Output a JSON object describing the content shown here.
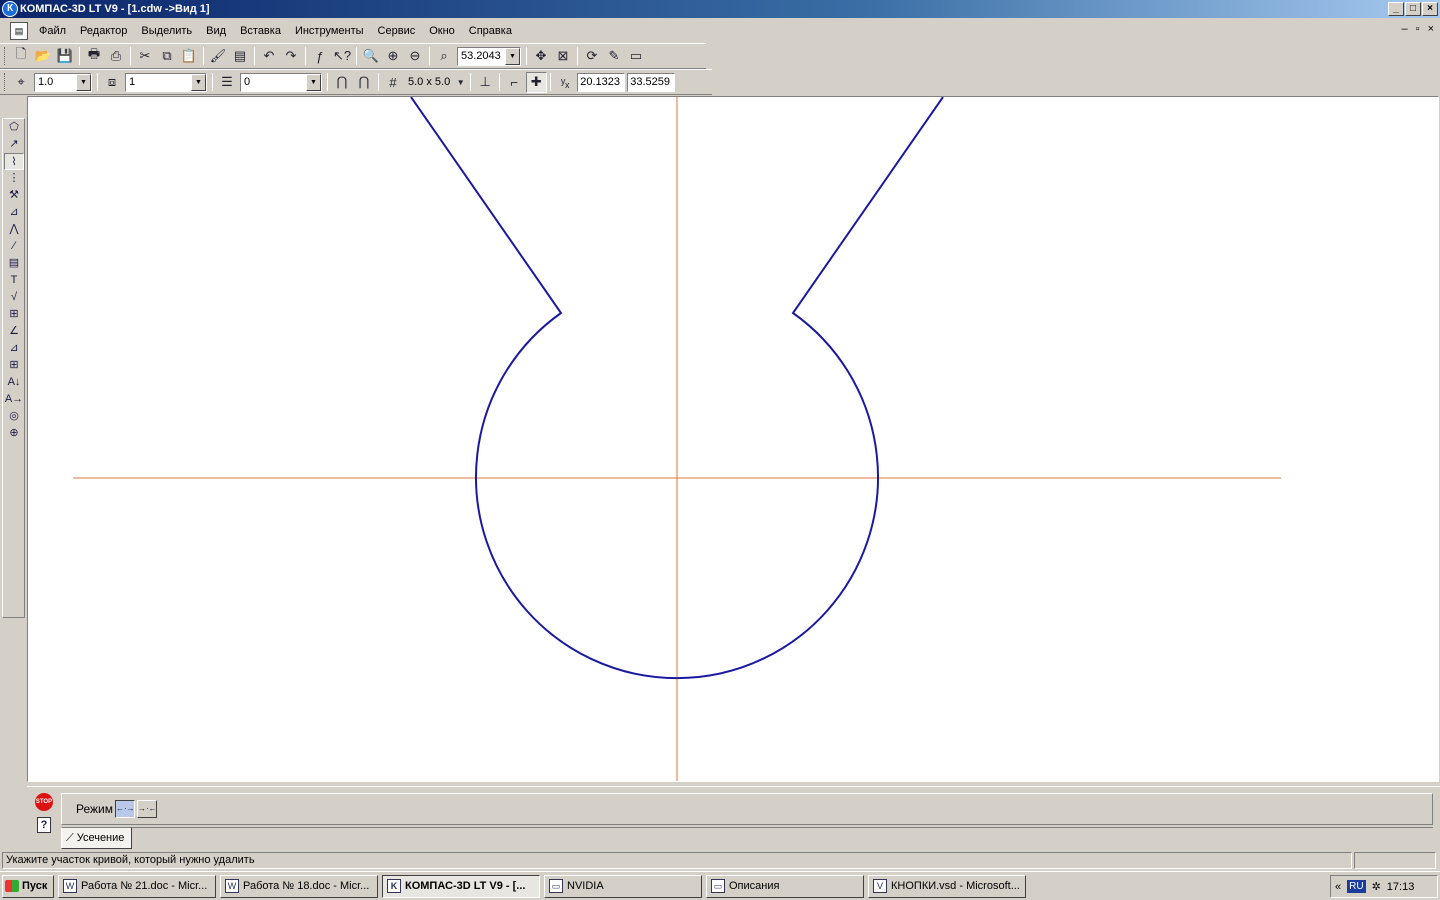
{
  "window": {
    "title": "КОМПАС-3D LT V9 - [1.cdw ->Вид 1]",
    "app_icon": "К",
    "buttons": [
      "_",
      "□",
      "×"
    ]
  },
  "menu": {
    "items": [
      "Файл",
      "Редактор",
      "Выделить",
      "Вид",
      "Вставка",
      "Инструменты",
      "Сервис",
      "Окно",
      "Справка"
    ],
    "mdi_buttons": [
      "–",
      "▫",
      "×"
    ]
  },
  "toolbar_standard": {
    "zoom_value": "53.2043"
  },
  "toolbar_current_state": {
    "step_value": "1.0",
    "layer_value": "1",
    "style_value": "0",
    "grid_label": "5.0 x 5.0",
    "coord_x": "20.1323",
    "coord_y": "33.5259"
  },
  "properties_panel": {
    "mode_label": "Режим",
    "tab_label": "Усечение",
    "stop_label": "STOP",
    "help_label": "?"
  },
  "statusbar": {
    "message": "Укажите участок кривой, который нужно удалить",
    "extra": ""
  },
  "taskbar": {
    "start_label": "Пуск",
    "tasks": [
      {
        "label": "Работа № 21.doc - Micr...",
        "icon": "W"
      },
      {
        "label": "Работа № 18.doc - Micr...",
        "icon": "W"
      },
      {
        "label": "КОМПАС-3D LT V9 - [...",
        "icon": "K"
      },
      {
        "label": "NVIDIA",
        "icon": "▭"
      },
      {
        "label": "Описания",
        "icon": "▭"
      },
      {
        "label": "КНОПКИ.vsd - Microsoft...",
        "icon": "V"
      }
    ],
    "tray_chevron": "«",
    "lang": "RU",
    "clock": "17:13"
  },
  "colors": {
    "contour": "#1a1aa0",
    "axis": "#d9783c"
  }
}
